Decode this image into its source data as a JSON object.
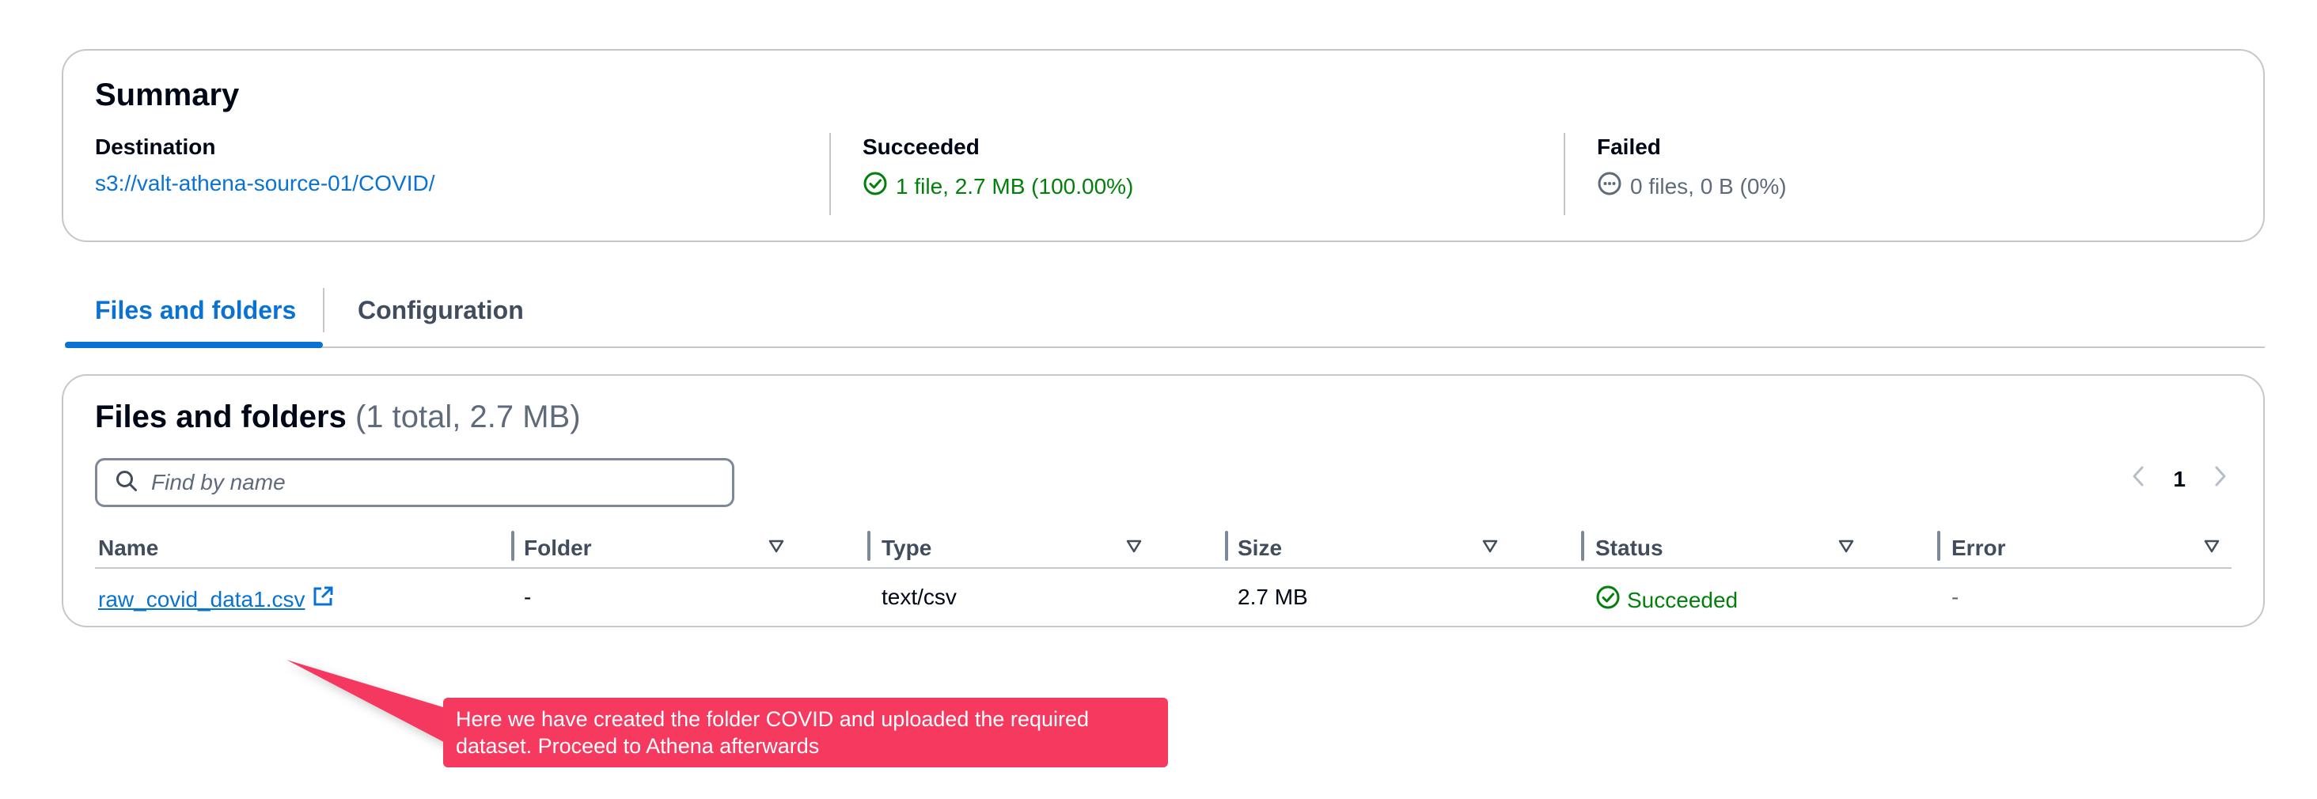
{
  "summary": {
    "title": "Summary",
    "destination": {
      "label": "Destination",
      "value": "s3://valt-athena-source-01/COVID/"
    },
    "succeeded": {
      "label": "Succeeded",
      "value": "1 file, 2.7 MB (100.00%)"
    },
    "failed": {
      "label": "Failed",
      "value": "0 files, 0 B (0%)"
    }
  },
  "tabs": [
    {
      "label": "Files and folders",
      "active": true
    },
    {
      "label": "Configuration",
      "active": false
    }
  ],
  "files": {
    "title": "Files and folders",
    "count": "(1 total, 2.7 MB)",
    "search_placeholder": "Find by name",
    "page": "1",
    "columns": [
      "Name",
      "Folder",
      "Type",
      "Size",
      "Status",
      "Error"
    ],
    "rows": [
      {
        "name": "raw_covid_data1.csv",
        "folder": "-",
        "type": "text/csv",
        "size": "2.7 MB",
        "status": "Succeeded",
        "error": "-"
      }
    ]
  },
  "callout": {
    "text": "Here we have created the folder COVID and uploaded the required dataset. Proceed to Athena afterwards"
  },
  "colors": {
    "link": "#0972d3",
    "success": "#037f0c",
    "border": "#c6c6cd",
    "callout": "#f5395f"
  },
  "icons": [
    "success-check-icon",
    "pending-ellipsis-icon",
    "search-icon",
    "chevron-left-icon",
    "chevron-right-icon",
    "sort-caret-icon",
    "external-link-icon"
  ]
}
